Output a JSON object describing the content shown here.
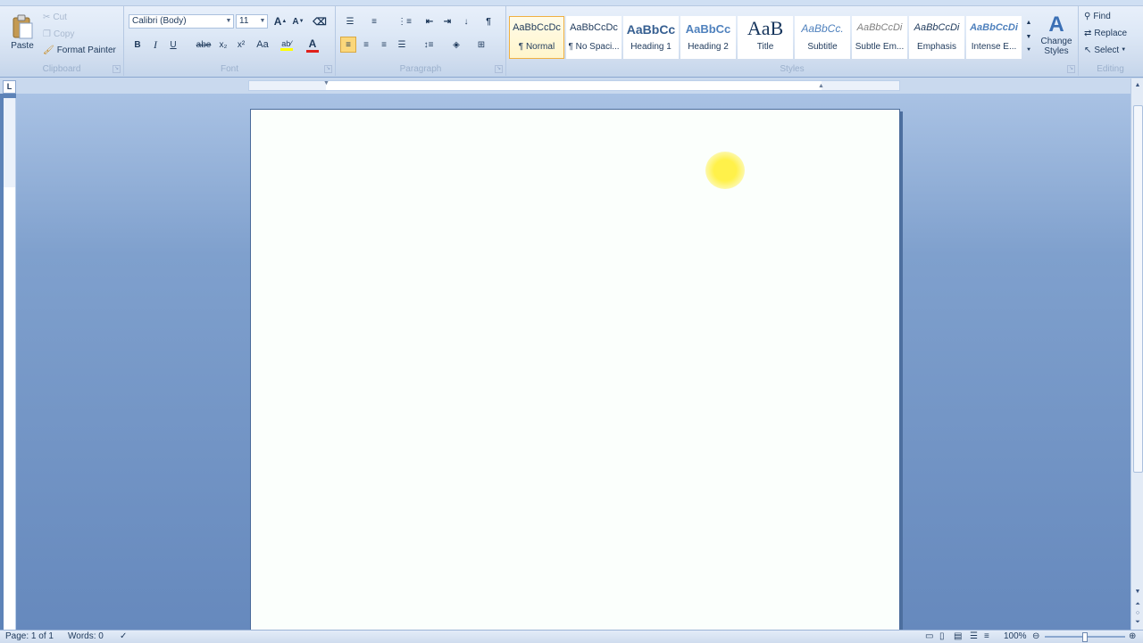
{
  "clipboard": {
    "label": "Clipboard",
    "paste": "Paste",
    "cut": "Cut",
    "copy": "Copy",
    "format_painter": "Format Painter"
  },
  "font": {
    "label": "Font",
    "family": "Calibri (Body)",
    "size": "11",
    "bold": "B",
    "italic": "I",
    "underline": "U",
    "strike": "abe",
    "subscript": "x₂",
    "superscript": "x²",
    "change_case": "Aa",
    "grow": "A",
    "shrink": "A",
    "highlight_color": "#ffff00",
    "font_color": "#e0201b"
  },
  "paragraph": {
    "label": "Paragraph",
    "pilcrow": "¶"
  },
  "styles": {
    "label": "Styles",
    "items": [
      {
        "sample": "AaBbCcDc",
        "name": "¶ Normal"
      },
      {
        "sample": "AaBbCcDc",
        "name": "¶ No Spaci..."
      },
      {
        "sample": "AaBbCc",
        "name": "Heading 1"
      },
      {
        "sample": "AaBbCc",
        "name": "Heading 2"
      },
      {
        "sample": "AaB",
        "name": "Title"
      },
      {
        "sample": "AaBbCc.",
        "name": "Subtitle"
      },
      {
        "sample": "AaBbCcDi",
        "name": "Subtle Em..."
      },
      {
        "sample": "AaBbCcDi",
        "name": "Emphasis"
      },
      {
        "sample": "AaBbCcDi",
        "name": "Intense E..."
      }
    ],
    "change_styles": "Change Styles"
  },
  "editing": {
    "label": "Editing",
    "find": "Find",
    "replace": "Replace",
    "select": "Select"
  },
  "ruler": {
    "tab_selector": "L"
  },
  "status": {
    "page": "Page: 1 of 1",
    "words": "Words: 0",
    "zoom": "100%"
  },
  "colors": {
    "accent_selected": "#f0b042",
    "cursor_highlight": "#fff14a"
  }
}
